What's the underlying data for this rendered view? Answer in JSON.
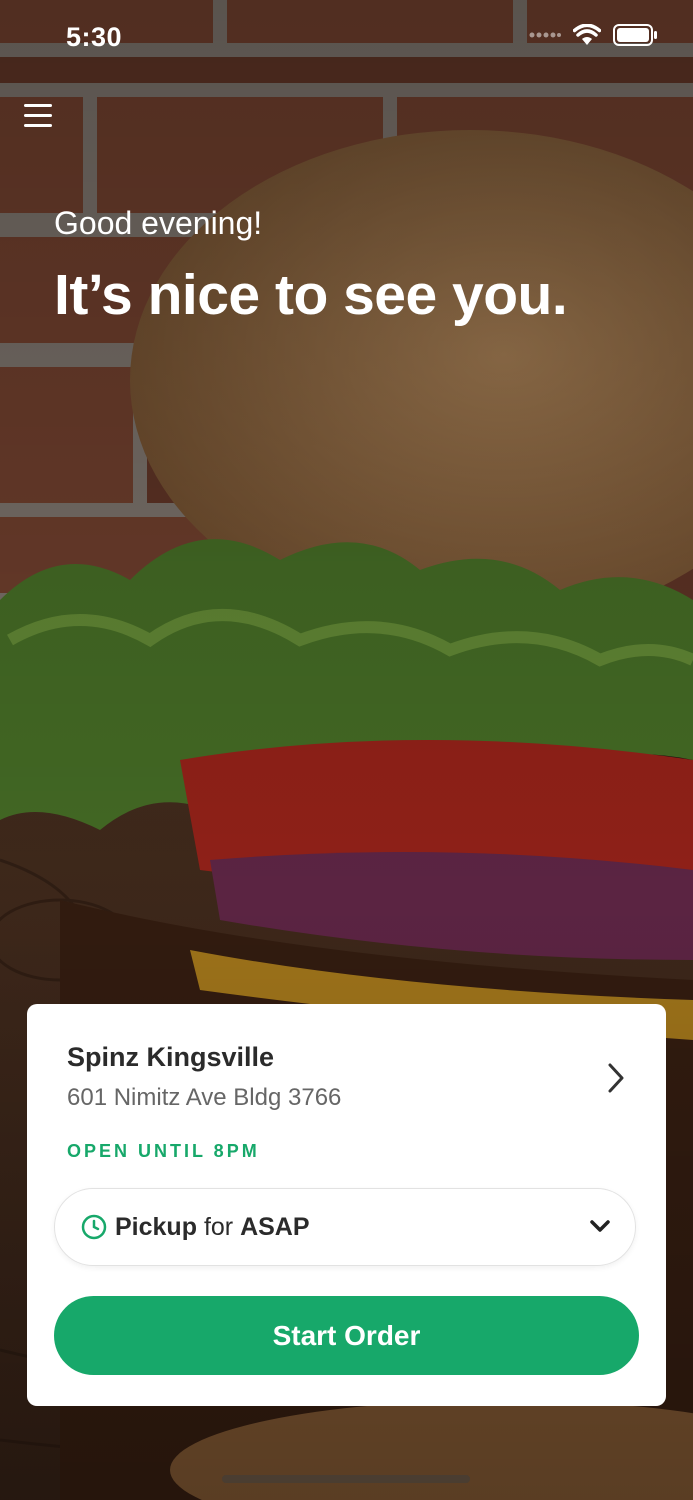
{
  "status_bar": {
    "time": "5:30"
  },
  "hero": {
    "greeting": "Good evening!",
    "headline": "It’s nice to see you."
  },
  "store_card": {
    "store_name": "Spinz Kingsville",
    "address": "601 Nimitz Ave Bldg 3766",
    "open_status": "OPEN UNTIL 8PM",
    "pickup": {
      "mode": "Pickup",
      "connector": "for",
      "time": "ASAP"
    },
    "start_order_label": "Start Order"
  },
  "colors": {
    "accent": "#17a86a",
    "card_bg": "#ffffff",
    "text_dark": "#2b2b2b",
    "text_muted": "#666666"
  },
  "icons": {
    "menu": "hamburger-menu-icon",
    "store_chevron": "chevron-right-icon",
    "pickup_clock": "clock-icon",
    "pickup_dropdown": "chevron-down-icon"
  }
}
